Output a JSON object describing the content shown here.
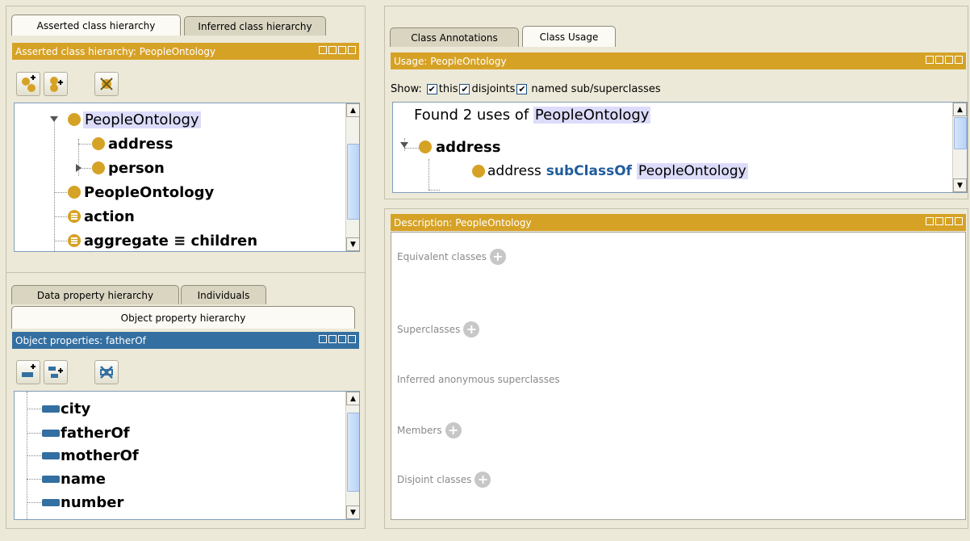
{
  "left_top": {
    "tabs": [
      "Asserted class hierarchy",
      "Inferred class hierarchy"
    ],
    "header": "Asserted class hierarchy: PeopleOntology",
    "tree": [
      {
        "label": "PeopleOntology",
        "icon": "class-dot-icon",
        "selected": true
      },
      {
        "label": "address",
        "icon": "class-dot-icon"
      },
      {
        "label": "person",
        "icon": "class-dot-icon"
      },
      {
        "label": "PeopleOntology",
        "icon": "class-dot-icon"
      },
      {
        "label": "action",
        "icon": "defined-class-icon"
      },
      {
        "label": "aggregate ≡ children",
        "icon": "defined-class-icon"
      }
    ]
  },
  "left_bottom": {
    "tabs": [
      "Data property hierarchy",
      "Individuals",
      "Object property hierarchy"
    ],
    "header": "Object properties: fatherOf",
    "tree": [
      {
        "label": "city"
      },
      {
        "label": "fatherOf"
      },
      {
        "label": "motherOf"
      },
      {
        "label": "name"
      },
      {
        "label": "number"
      }
    ]
  },
  "usage": {
    "tabs": [
      "Class Annotations",
      "Class Usage"
    ],
    "header": "Usage: PeopleOntology",
    "show_label": "Show:",
    "options": [
      {
        "label": "this",
        "checked": true
      },
      {
        "label": "disjoints",
        "checked": true
      },
      {
        "label": "named sub/superclasses",
        "checked": true
      }
    ],
    "found_prefix": "Found 2 uses of",
    "found_term": "PeopleOntology",
    "group": "address",
    "axiom": {
      "subject": "address",
      "keyword": "subClassOf",
      "object": "PeopleOntology"
    }
  },
  "description": {
    "header": "Description: PeopleOntology",
    "sections": [
      {
        "label": "Equivalent classes",
        "addable": true
      },
      {
        "label": "Superclasses",
        "addable": true
      },
      {
        "label": "Inferred anonymous superclasses",
        "addable": false
      },
      {
        "label": "Members",
        "addable": true
      },
      {
        "label": "Disjoint classes",
        "addable": true
      }
    ]
  },
  "colors": {
    "class_gold": "#d6a226",
    "property_blue": "#336fa1",
    "selection": "#dcdcfa",
    "keyword": "#1f5c9c"
  }
}
